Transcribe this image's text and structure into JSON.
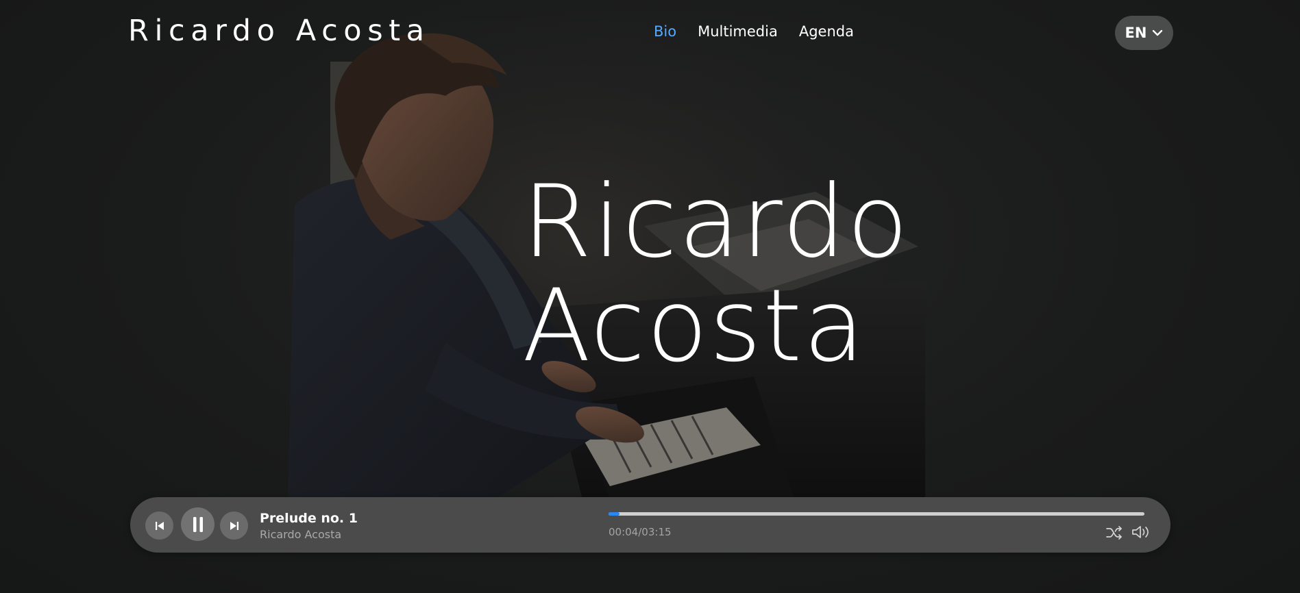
{
  "header": {
    "site_title": "Ricardo Acosta",
    "nav": {
      "bio": "Bio",
      "multimedia": "Multimedia",
      "agenda": "Agenda"
    },
    "active_nav": "Bio",
    "language": "EN"
  },
  "hero": {
    "line1": "Ricardo",
    "line2": "Acosta"
  },
  "player": {
    "track_title": "Prelude no. 1",
    "track_artist": "Ricardo Acosta",
    "elapsed": "00:04",
    "separator": "/",
    "duration": "03:15",
    "progress_fraction": 0.021,
    "state": "playing"
  },
  "icons": {
    "prev": "skip-previous-icon",
    "pause": "pause-icon",
    "next": "skip-next-icon",
    "shuffle": "shuffle-icon",
    "volume": "volume-icon",
    "language_dropdown": "chevron-down-icon"
  },
  "colors": {
    "background": "#1b1c1c",
    "accent": "#57a8ff",
    "progress": "#2b86f0",
    "player_bg": "#4b4b4b"
  }
}
